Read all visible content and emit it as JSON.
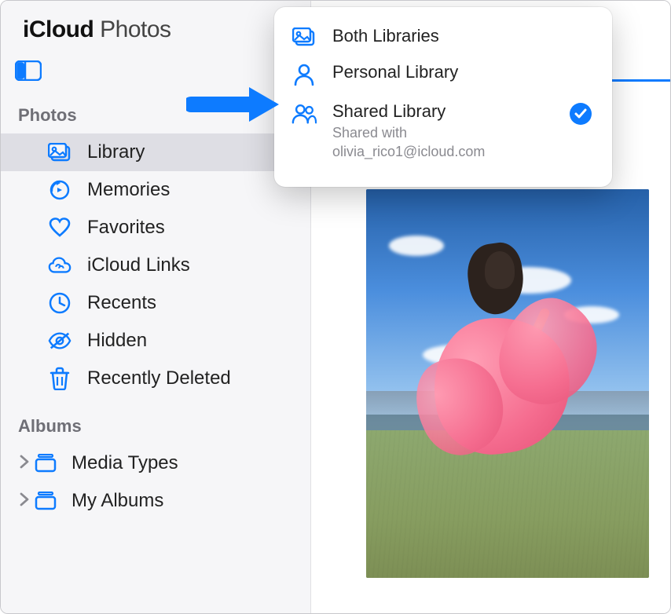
{
  "brand": {
    "title_strong": "iCloud",
    "title_thin": "Photos"
  },
  "sidebar": {
    "section_photos": "Photos",
    "section_albums": "Albums",
    "items": [
      {
        "label": "Library",
        "icon": "library-icon",
        "selected": true
      },
      {
        "label": "Memories",
        "icon": "memories-icon"
      },
      {
        "label": "Favorites",
        "icon": "heart-icon"
      },
      {
        "label": "iCloud Links",
        "icon": "cloud-link-icon"
      },
      {
        "label": "Recents",
        "icon": "clock-icon"
      },
      {
        "label": "Hidden",
        "icon": "eye-slash-icon"
      },
      {
        "label": "Recently Deleted",
        "icon": "trash-icon"
      }
    ],
    "albums": [
      {
        "label": "Media Types",
        "icon": "album-icon"
      },
      {
        "label": "My Albums",
        "icon": "album-icon"
      }
    ]
  },
  "dropdown": {
    "items": [
      {
        "title": "Both Libraries",
        "icon": "library-icon",
        "selected": false
      },
      {
        "title": "Personal Library",
        "icon": "person-icon",
        "selected": false
      },
      {
        "title": "Shared Library",
        "icon": "people-icon",
        "selected": true,
        "subtitle_line1": "Shared with",
        "subtitle_line2": "olivia_rico1@icloud.com"
      }
    ]
  },
  "annotation": {
    "arrow_color": "#0d7bff"
  }
}
